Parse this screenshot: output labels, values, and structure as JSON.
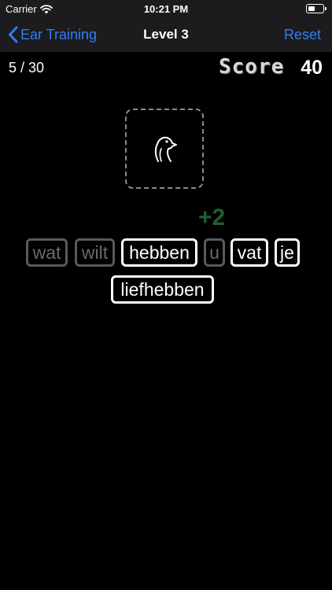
{
  "status_bar": {
    "carrier": "Carrier",
    "time": "10:21 PM"
  },
  "nav": {
    "back_label": "Ear Training",
    "title": "Level 3",
    "reset_label": "Reset"
  },
  "progress": {
    "current": 5,
    "total": 30,
    "text": "5 / 30"
  },
  "score": {
    "label": "Score",
    "value": "40"
  },
  "points_gained": "+2",
  "words": [
    {
      "text": "wat",
      "used": true
    },
    {
      "text": "wilt",
      "used": true
    },
    {
      "text": "hebben",
      "used": false
    },
    {
      "text": "u",
      "used": true
    },
    {
      "text": "vat",
      "used": false
    },
    {
      "text": "je",
      "used": false
    },
    {
      "text": "liefhebben",
      "used": false
    }
  ],
  "colors": {
    "accent": "#2f7df6",
    "points": "#1f5e2e",
    "used_tile": "#5a5a5a",
    "background": "#000000"
  },
  "icons": {
    "audio": "bird-icon",
    "back": "chevron-left-icon"
  }
}
